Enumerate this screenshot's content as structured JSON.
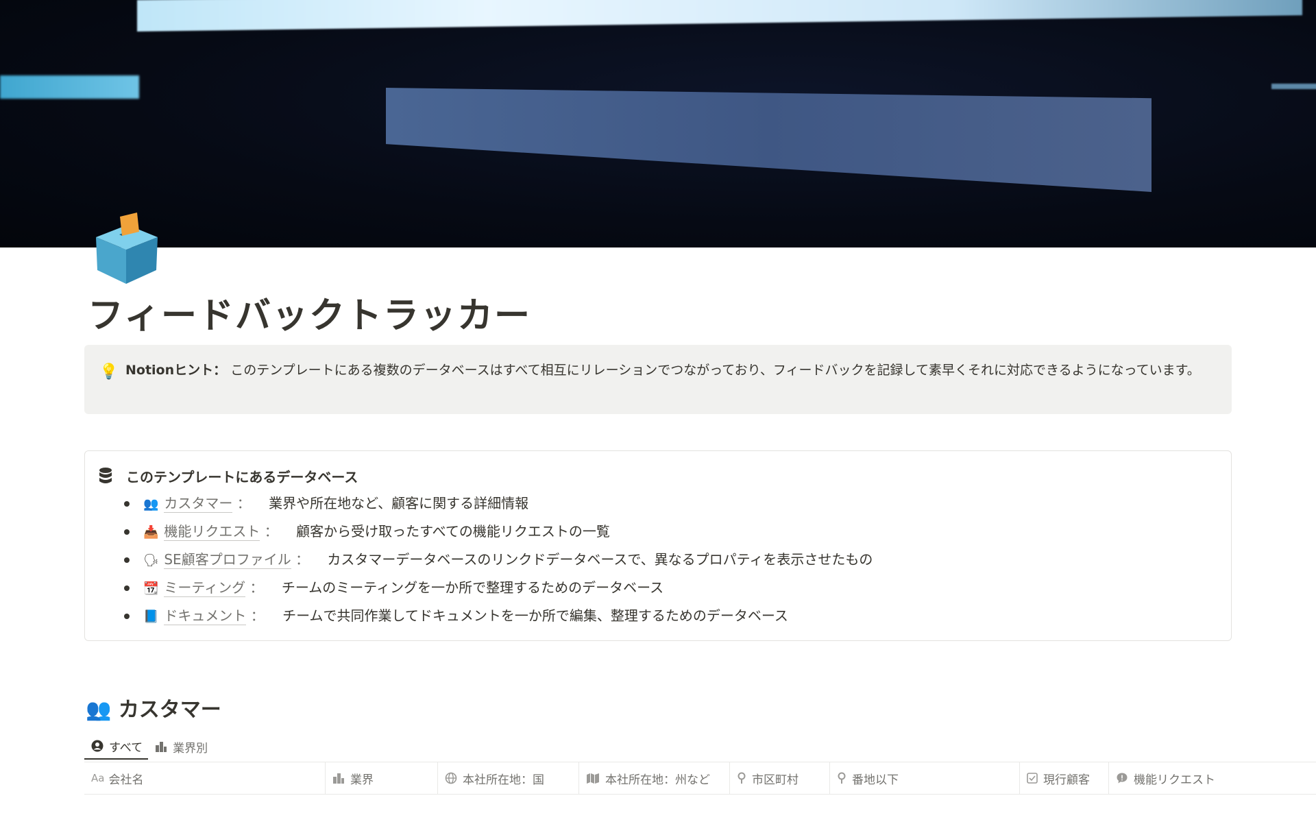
{
  "cover": {
    "description_colors": {
      "dark": "#060a14",
      "beam": "#cfe8f8",
      "panel": "#44608c"
    }
  },
  "page": {
    "icon": "ballot-box-icon",
    "title": "フィードバックトラッカー"
  },
  "callout": {
    "icon": "light-bulb-icon",
    "label": "Notionヒント：",
    "text": "このテンプレートにある複数のデータベースはすべて相互にリレーションでつながっており、フィードバックを記録して素早くそれに対応できるようになっています。"
  },
  "databases": {
    "icon": "database-icon",
    "heading": "このテンプレートにあるデータベース",
    "items": [
      {
        "emoji": "👥",
        "link": "カスタマー",
        "description": "業界や所在地など、顧客に関する詳細情報"
      },
      {
        "emoji": "📥",
        "link": "機能リクエスト",
        "description": "顧客から受け取ったすべての機能リクエストの一覧"
      },
      {
        "emoji": "🗣",
        "link": "SE顧客プロファイル",
        "description": "カスタマーデータベースのリンクドデータベースで、異なるプロパティを表示させたもの"
      },
      {
        "emoji": "📆",
        "link": "ミーティング",
        "description": "チームのミーティングを一か所で整理するためのデータベース"
      },
      {
        "emoji": "📘",
        "link": "ドキュメント",
        "description": "チームで共同作業してドキュメントを一か所で編集、整理するためのデータベース"
      }
    ],
    "colon": "："
  },
  "customers": {
    "emoji": "👥",
    "title": "カスタマー",
    "tabs": [
      {
        "icon": "person-circle-icon",
        "label": "すべて"
      },
      {
        "icon": "building-icon",
        "label": "業界別"
      }
    ],
    "columns": [
      {
        "icon": "text-icon",
        "icon_text": "Aa",
        "label": "会社名"
      },
      {
        "icon": "building-icon",
        "label": "業界"
      },
      {
        "icon": "globe-icon",
        "label": "本社所在地：国"
      },
      {
        "icon": "map-icon",
        "label": "本社所在地：州など"
      },
      {
        "icon": "pin-icon",
        "label": "市区町村"
      },
      {
        "icon": "pin-icon",
        "label": "番地以下"
      },
      {
        "icon": "checkbox-icon",
        "label": "現行顧客"
      },
      {
        "icon": "speech-bubble-icon",
        "label": "機能リクエスト"
      }
    ]
  }
}
